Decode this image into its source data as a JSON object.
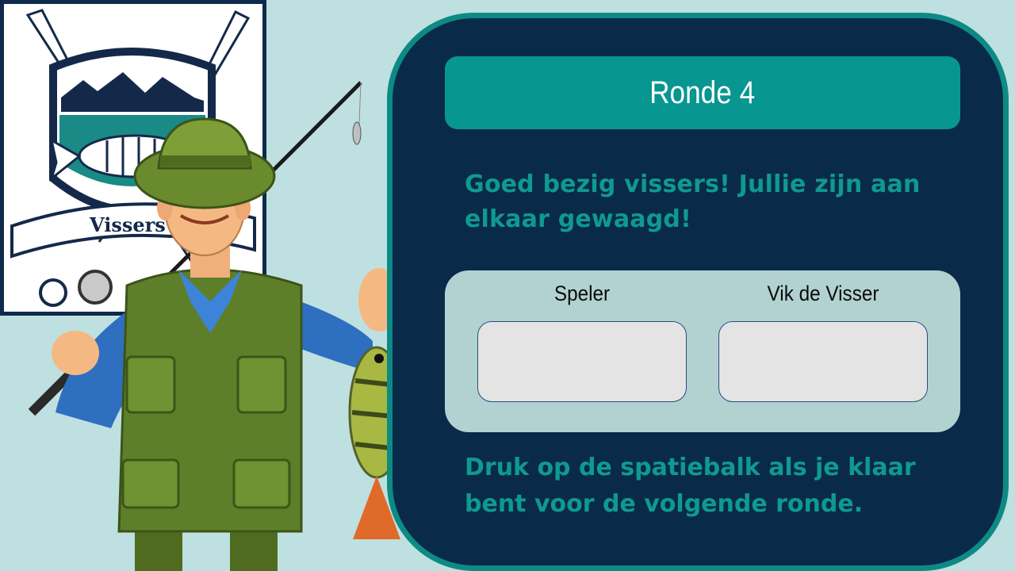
{
  "logo": {
    "text": "Vissers"
  },
  "round": {
    "title": "Ronde 4"
  },
  "message": "Goed bezig vissers! Jullie zijn aan elkaar gewaagd!",
  "scores": {
    "player1": {
      "label": "Speler",
      "value": ""
    },
    "player2": {
      "label": "Vik de Visser",
      "value": ""
    }
  },
  "footer": "Druk op de spatiebalk als je klaar bent voor de volgende ronde.",
  "colors": {
    "background": "#bfe0e0",
    "panel": "#0a2a4a",
    "panel_border": "#0e8a85",
    "header": "#079690",
    "text_accent": "#0e9a90"
  }
}
